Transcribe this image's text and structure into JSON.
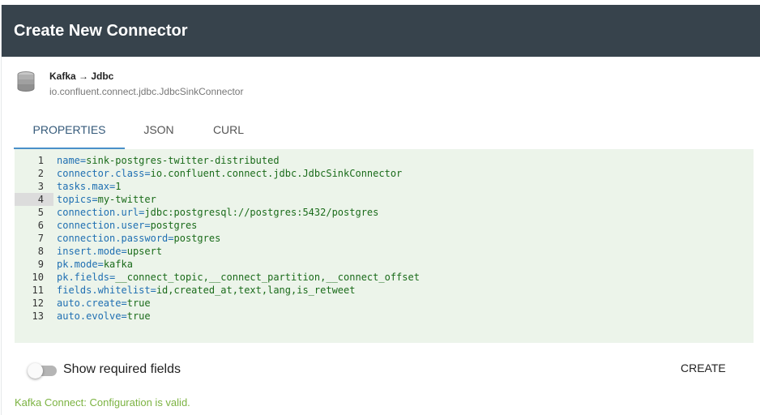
{
  "dialog": {
    "title": "Create New Connector"
  },
  "connector": {
    "name": "Kafka → Jdbc",
    "class": "io.confluent.connect.jdbc.JdbcSinkConnector",
    "icon": "database-icon"
  },
  "tabs": [
    {
      "label": "PROPERTIES",
      "active": true
    },
    {
      "label": "JSON",
      "active": false
    },
    {
      "label": "CURL",
      "active": false
    }
  ],
  "editor": {
    "highlighted_line": 4,
    "lines": [
      {
        "num": "1",
        "key": "name",
        "value": "sink-postgres-twitter-distributed"
      },
      {
        "num": "2",
        "key": "connector.class",
        "value": "io.confluent.connect.jdbc.JdbcSinkConnector"
      },
      {
        "num": "3",
        "key": "tasks.max",
        "value": "1"
      },
      {
        "num": "4",
        "key": "topics",
        "value": "my-twitter"
      },
      {
        "num": "5",
        "key": "connection.url",
        "value": "jdbc:postgresql://postgres:5432/postgres"
      },
      {
        "num": "6",
        "key": "connection.user",
        "value": "postgres"
      },
      {
        "num": "7",
        "key": "connection.password",
        "value": "postgres"
      },
      {
        "num": "8",
        "key": "insert.mode",
        "value": "upsert"
      },
      {
        "num": "9",
        "key": "pk.mode",
        "value": "kafka"
      },
      {
        "num": "10",
        "key": "pk.fields",
        "value": "__connect_topic,__connect_partition,__connect_offset"
      },
      {
        "num": "11",
        "key": "fields.whitelist",
        "value": "id,created_at,text,lang,is_retweet"
      },
      {
        "num": "12",
        "key": "auto.create",
        "value": "true"
      },
      {
        "num": "13",
        "key": "auto.evolve",
        "value": "true"
      }
    ]
  },
  "footer": {
    "toggle_label": "Show required fields",
    "toggle_on": false,
    "create_label": "CREATE",
    "status": "Kafka Connect: Configuration is valid."
  },
  "colors": {
    "header_bg": "#37434c",
    "editor_bg": "#ecf4ea",
    "key": "#1f6fb2",
    "value": "#1a6b1a",
    "status": "#7cb342"
  }
}
